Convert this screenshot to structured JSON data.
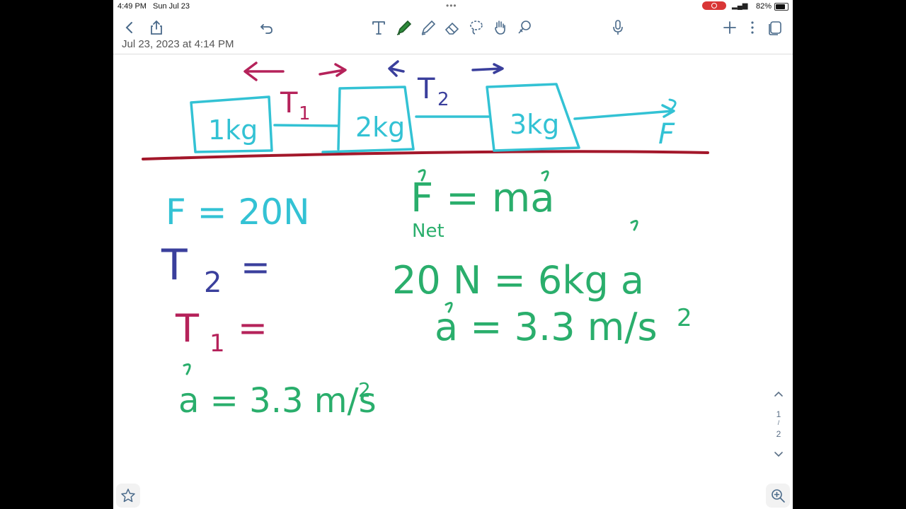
{
  "status": {
    "time": "4:49 PM",
    "date": "Sun Jul 23",
    "battery": "82%"
  },
  "note": {
    "subtitle": "Jul 23, 2023 at 4:14 PM",
    "page_current": "1",
    "page_sep": "/",
    "page_total": "2"
  },
  "ink": {
    "block1": "1kg",
    "block2": "2kg",
    "block3": "3kg",
    "t1": "T",
    "t1_sub": "1",
    "t2": "T",
    "t2_sub": "2",
    "force": "F",
    "eq_f": "F = 20N",
    "eq_t2": "T",
    "eq_t2_sub": "2",
    "eq_t2_tail": "=",
    "eq_t1": "T",
    "eq_t1_sub": "1",
    "eq_t1_tail": "=",
    "eq_a_left": "a = 3.3 m/s",
    "eq_a_left_exp": "2",
    "eq_newton": "F = ma",
    "eq_newton_sub": "Net",
    "eq_sub": "20 N = 6kg a",
    "eq_a_right": "a = 3.3 m/s",
    "eq_a_right_exp": "2"
  },
  "colors": {
    "cyan": "#33c2d4",
    "magenta": "#b5225a",
    "navy": "#3a3f9c",
    "green": "#2aae6c",
    "ground": "#a3172a",
    "toolbar_icon": "#4a6a8a",
    "accent_green": "#2e8b3a"
  },
  "icons": [
    "back-chevron-icon",
    "share-icon",
    "undo-icon",
    "text-tool-icon",
    "pen-icon",
    "highlighter-icon",
    "eraser-icon",
    "lasso-icon",
    "hand-icon",
    "shapes-icon",
    "microphone-icon",
    "plus-icon",
    "more-icon",
    "pages-icon",
    "star-icon",
    "zoom-in-icon",
    "chevron-up-icon",
    "chevron-down-icon"
  ]
}
